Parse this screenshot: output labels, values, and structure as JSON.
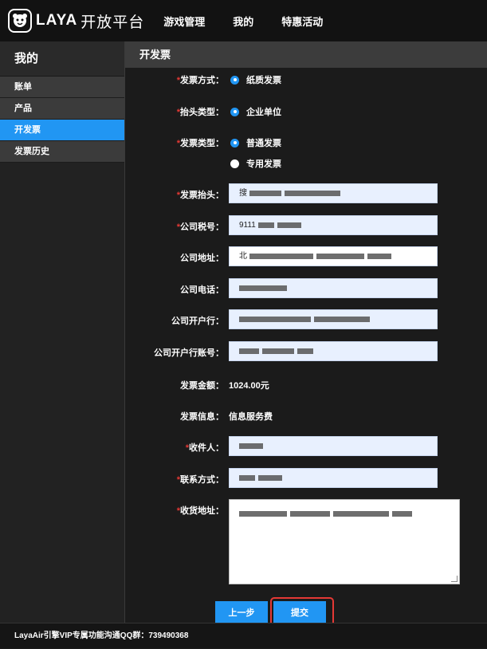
{
  "brand": {
    "logo_text": "LAYA",
    "logo_cn": "开放平台"
  },
  "nav": [
    "游戏管理",
    "我的",
    "特惠活动"
  ],
  "sidebar": {
    "title": "我的",
    "items": [
      {
        "label": "账单"
      },
      {
        "label": "产品"
      },
      {
        "label": "开发票"
      },
      {
        "label": "发票历史"
      }
    ]
  },
  "main": {
    "title": "开发票",
    "form": {
      "invoice_method": {
        "label": "发票方式：",
        "option": "纸质发票"
      },
      "title_type": {
        "label": "抬头类型：",
        "option": "企业单位"
      },
      "invoice_type": {
        "label": "发票类型：",
        "options": [
          "普通发票",
          "专用发票"
        ]
      },
      "invoice_title": {
        "label": "发票抬头：",
        "value": "搜"
      },
      "tax_id": {
        "label": "公司税号：",
        "value": "9111"
      },
      "company_address": {
        "label": "公司地址：",
        "value": "北"
      },
      "company_phone": {
        "label": "公司电话：",
        "value": ""
      },
      "bank": {
        "label": "公司开户行：",
        "value": ""
      },
      "bank_account": {
        "label": "公司开户行账号：",
        "value": ""
      },
      "amount": {
        "label": "发票金额：",
        "value": "1024.00元"
      },
      "info": {
        "label": "发票信息：",
        "value": "信息服务费"
      },
      "recipient": {
        "label": "收件人：",
        "value": ""
      },
      "contact": {
        "label": "联系方式：",
        "value": ""
      },
      "shipping_address": {
        "label": "收货地址：",
        "value": ""
      }
    },
    "buttons": {
      "prev": "上一步",
      "submit": "提交"
    }
  },
  "footer": {
    "text": "LayaAir引擎VIP专属功能沟通QQ群：739490368"
  },
  "colors": {
    "accent": "#2196f3",
    "required": "#e53935"
  }
}
